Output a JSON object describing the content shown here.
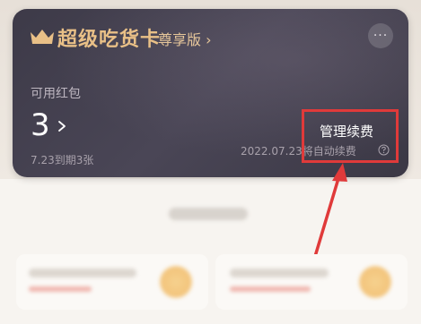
{
  "card": {
    "brand_title": "超级吃货卡",
    "edition": "尊享版 ›",
    "more_label": "···",
    "label": "可用红包",
    "count": "3",
    "expire_note": "7.23到期3张",
    "manage_link": "管理续费",
    "renew_note": "2022.07.23将自动续费"
  },
  "colors": {
    "card_background": "#3d3a48",
    "gold_accent": "#e9c087",
    "annotation": "#e03a3a"
  },
  "icons": {
    "crown": "crown-icon",
    "chevron": "chevron-right-icon",
    "help": "help-icon"
  }
}
